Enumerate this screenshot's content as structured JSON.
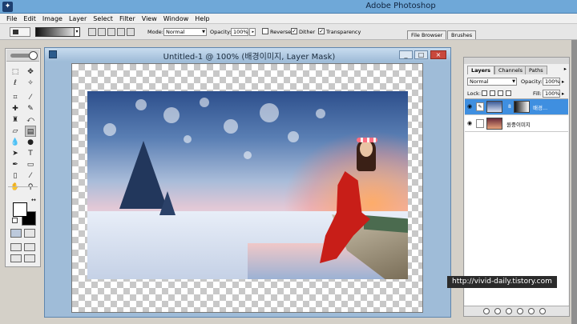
{
  "app": {
    "title": "Adobe Photoshop",
    "icon_letter": ""
  },
  "menu": [
    "File",
    "Edit",
    "Image",
    "Layer",
    "Select",
    "Filter",
    "View",
    "Window",
    "Help"
  ],
  "options": {
    "mode_label": "Mode:",
    "mode_value": "Normal",
    "opacity_label": "Opacity:",
    "opacity_value": "100%",
    "reverse_label": "Reverse",
    "dither_label": "Dither",
    "transparency_label": "Transparency",
    "dither_checked": "✓",
    "transparency_checked": "✓",
    "file_browser_tab": "File Browser",
    "brushes_tab": "Brushes"
  },
  "document": {
    "title": "Untitled-1 @ 100% (배경이미지, Layer Mask)",
    "min_glyph": "_",
    "max_glyph": "□",
    "close_glyph": "×"
  },
  "tools": [
    {
      "name": "marquee",
      "glyph": "⬚"
    },
    {
      "name": "move",
      "glyph": "✥"
    },
    {
      "name": "lasso",
      "glyph": "ℓ"
    },
    {
      "name": "magic-wand",
      "glyph": "✧"
    },
    {
      "name": "crop",
      "glyph": "⌗"
    },
    {
      "name": "slice",
      "glyph": "⁄"
    },
    {
      "name": "healing",
      "glyph": "✚"
    },
    {
      "name": "brush",
      "glyph": "✎"
    },
    {
      "name": "clone-stamp",
      "glyph": "♜"
    },
    {
      "name": "history-brush",
      "glyph": "⤺"
    },
    {
      "name": "eraser",
      "glyph": "▱"
    },
    {
      "name": "gradient",
      "glyph": "▤"
    },
    {
      "name": "blur",
      "glyph": "💧"
    },
    {
      "name": "dodge",
      "glyph": "●"
    },
    {
      "name": "path-select",
      "glyph": "➤"
    },
    {
      "name": "type",
      "glyph": "T"
    },
    {
      "name": "pen",
      "glyph": "✒"
    },
    {
      "name": "shape",
      "glyph": "▭"
    },
    {
      "name": "notes",
      "glyph": "▯"
    },
    {
      "name": "eyedropper",
      "glyph": "⁄"
    },
    {
      "name": "hand",
      "glyph": "✋"
    },
    {
      "name": "zoom",
      "glyph": "⚲"
    }
  ],
  "layers_panel": {
    "tabs": [
      "Layers",
      "Channels",
      "Paths"
    ],
    "blend_mode": "Normal",
    "opacity_label": "Opacity:",
    "opacity_value": "100%",
    "lock_label": "Lock:",
    "fill_label": "Fill:",
    "fill_value": "100%",
    "layers": [
      {
        "name": "배경...",
        "selected": true
      },
      {
        "name": "원중이미지",
        "selected": false
      }
    ]
  },
  "watermark": "http://vivid-daily.tistory.com"
}
